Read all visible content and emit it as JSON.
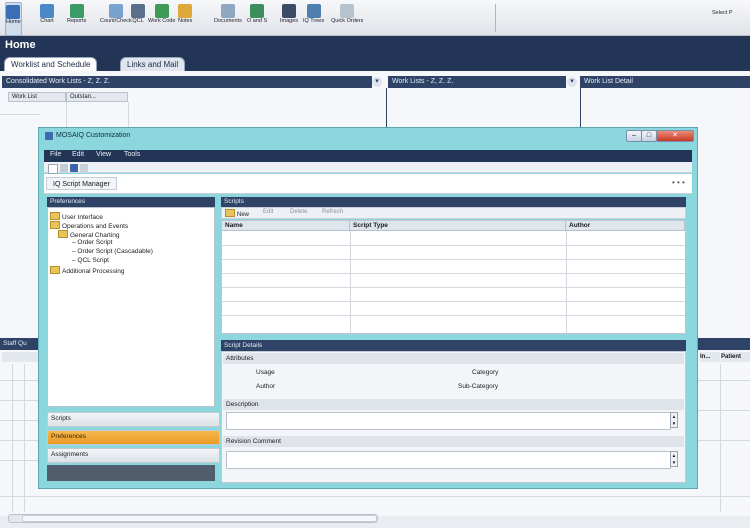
{
  "ribbon": {
    "buttons": [
      {
        "label": "Home",
        "icon": "home-icon",
        "color": "#3a6fb8"
      },
      {
        "label": "Chart",
        "icon": "chart-icon",
        "color": "#4a88c8"
      },
      {
        "label": "Reports",
        "icon": "reports-icon",
        "color": "#3c9b66"
      },
      {
        "label": "Count/Check",
        "icon": "count-check-icon",
        "color": "#7aa2cf"
      },
      {
        "label": "QCL",
        "icon": "qcl-icon",
        "color": "#5a6f8c"
      },
      {
        "label": "Work Code",
        "icon": "work-code-icon",
        "color": "#3f9a58"
      },
      {
        "label": "Notes",
        "icon": "notes-icon",
        "color": "#e0a83a"
      },
      {
        "label": "Documents",
        "icon": "documents-icon",
        "color": "#8fa8c2"
      },
      {
        "label": "O and S",
        "icon": "o-and-s-icon",
        "color": "#3a8f5c"
      },
      {
        "label": "Images",
        "icon": "images-icon",
        "color": "#3c4c66"
      },
      {
        "label": "IQ Trees",
        "icon": "iq-trees-icon",
        "color": "#4f7fb0"
      },
      {
        "label": "Quick Orders",
        "icon": "quick-orders-icon",
        "color": "#b7c2cf"
      }
    ],
    "extra": "Select P"
  },
  "home_title": "Home",
  "tabs": [
    "Worklist and Schedule",
    "Links and Mail"
  ],
  "panels": {
    "consolidated": "Consolidated Work Lists - Z, Z. Z.",
    "work_lists": "Work Lists - Z, Z. Z.",
    "detail": "Work List Detail",
    "col_worklist": "Work List",
    "col_outstanding": "Outstan...",
    "staff": "Staff Qu",
    "right_col1": "In...",
    "right_col2": "Patient"
  },
  "modal": {
    "title": "MOSAIQ Customization",
    "buttons": {
      "minimize": "–",
      "maximize": "□",
      "close": "✕"
    },
    "menu": [
      "File",
      "Edit",
      "View",
      "Tools"
    ],
    "doc_tab": "IQ Script Manager",
    "doc_dots": "• • •",
    "preferences_header": "Preferences",
    "tree": [
      {
        "label": "User Interface",
        "level": 0,
        "folder": true
      },
      {
        "label": "Operations and Events",
        "level": 0,
        "folder": true
      },
      {
        "label": "General Charting",
        "level": 1,
        "folder": true
      },
      {
        "label": "Order Script",
        "level": 2,
        "folder": false
      },
      {
        "label": "Order Script (Cascadable)",
        "level": 2,
        "folder": false
      },
      {
        "label": "QCL Script",
        "level": 2,
        "folder": false
      },
      {
        "label": "Additional Processing",
        "level": 0,
        "folder": true
      }
    ],
    "sections": [
      "Scripts",
      "Preferences",
      "Assignments"
    ],
    "scripts_header": "Scripts",
    "scripts_tools": [
      "New",
      "Edit",
      "Delete",
      "Refresh"
    ],
    "columns": [
      "Name",
      "Script Type",
      "Author"
    ],
    "details_header": "Script Details",
    "attributes_label": "Attributes",
    "usage_label": "Usage",
    "author_label": "Author",
    "category_label": "Category",
    "subcategory_label": "Sub-Category",
    "description_label": "Description",
    "revision_label": "Revision Comment"
  }
}
